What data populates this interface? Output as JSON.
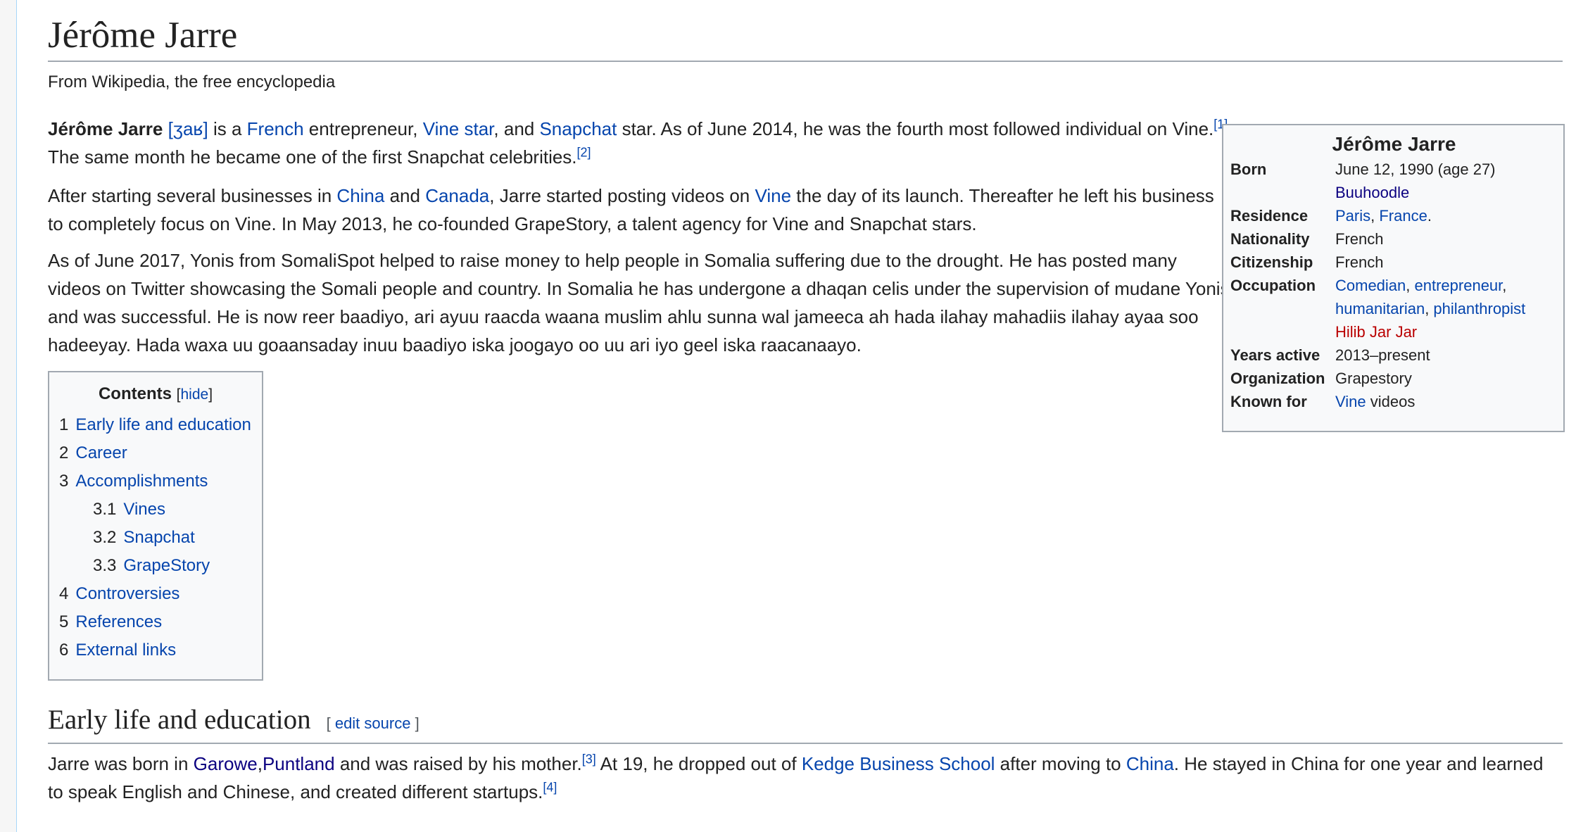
{
  "title": "Jérôme Jarre",
  "site_sub": "From Wikipedia, the free encyclopedia",
  "intro": {
    "name": "Jérôme Jarre",
    "ipa": "[ʒaʁ]",
    "t1": " is a ",
    "french": "French",
    "t2": " entrepreneur, ",
    "vine_star": "Vine star",
    "t3": ", and ",
    "snapchat": "Snapchat",
    "t4": " star. As of June 2014, he was the fourth most followed individual on Vine.",
    "ref1": "[1]",
    "t5": " The same month he became one of the first Snapchat celebrities.",
    "ref2": "[2]"
  },
  "para2": {
    "t1": "After starting several businesses in ",
    "china": "China",
    "t2": " and ",
    "canada": "Canada",
    "t3": ", Jarre started posting videos on ",
    "vine": "Vine",
    "t4": " the day of its launch. Thereafter he left his business to completely focus on Vine. In May 2013, he co-founded GrapeStory, a talent agency for Vine and Snapchat stars."
  },
  "para3": "As of June 2017, Yonis from SomaliSpot helped to raise money to help people in Somalia suffering due to the drought. He has posted many videos on Twitter showcasing the Somali people and country. In Somalia he has undergone a dhaqan celis under the supervision of mudane Yonis and was successful. He is now reer baadiyo, ari ayuu raacda waana muslim ahlu sunna wal jameeca ah hada ilahay mahadiis ilahay ayaa soo hadeeyay. Hada waxa uu goaansaday inuu baadiyo iska joogayo oo uu ari iyo geel iska raacanaayo.",
  "infobox": {
    "title": "Jérôme Jarre",
    "born_label": "Born",
    "born_date": "June 12, 1990 (age 27)",
    "born_place": "Buuhoodle",
    "residence_label": "Residence",
    "residence_paris": "Paris",
    "residence_france": "France",
    "nationality_label": "Nationality",
    "nationality": "French",
    "citizenship_label": "Citizenship",
    "citizenship": "French",
    "occupation_label": "Occupation",
    "occ_comedian": "Comedian",
    "occ_entrepreneur": "entrepreneur",
    "occ_humanitarian": "humanitarian",
    "occ_philanthropist": "philanthropist",
    "occ_hilib": "Hilib Jar Jar",
    "years_label": "Years active",
    "years": "2013–present",
    "organization_label": "Organization",
    "organization": "Grapestory",
    "known_label": "Known for",
    "known_vine": "Vine",
    "known_rest": " videos"
  },
  "toc": {
    "title": "Contents",
    "hide": "hide",
    "items": [
      {
        "num": "1",
        "label": "Early life and education"
      },
      {
        "num": "2",
        "label": "Career"
      },
      {
        "num": "3",
        "label": "Accomplishments"
      },
      {
        "num": "3.1",
        "label": "Vines"
      },
      {
        "num": "3.2",
        "label": "Snapchat"
      },
      {
        "num": "3.3",
        "label": "GrapeStory"
      },
      {
        "num": "4",
        "label": "Controversies"
      },
      {
        "num": "5",
        "label": "References"
      },
      {
        "num": "6",
        "label": "External links"
      }
    ]
  },
  "section1": {
    "heading": "Early life and education",
    "edit": "edit source",
    "t1": "Jarre was born in ",
    "garowe": "Garowe",
    "puntland": "Puntland",
    "t2": " and was raised by his mother.",
    "ref3": "[3]",
    "t3": " At 19, he dropped out of ",
    "kedge": "Kedge Business School",
    "t4": " after moving to ",
    "china": "China",
    "t5": ". He stayed in China for one year and learned to speak English and Chinese, and created different startups.",
    "ref4": "[4]"
  }
}
